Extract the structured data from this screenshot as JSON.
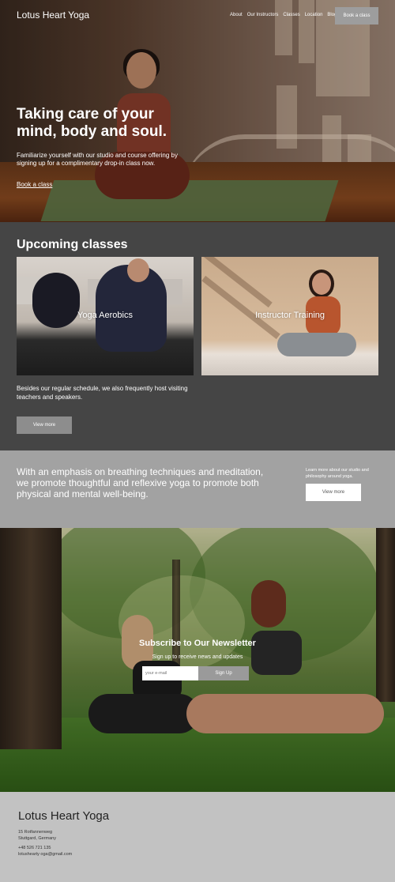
{
  "nav": {
    "logo": "Lotus Heart Yoga",
    "links": [
      "About",
      "Our Instructors",
      "Classes",
      "Location",
      "Blog"
    ],
    "cta": "Book a class"
  },
  "hero": {
    "title": "Taking care of your mind, body and soul.",
    "subtitle": "Familiarize yourself with our studio and course offering by signing up for a complimentary drop-in class now.",
    "link": "Book a class"
  },
  "classes": {
    "title": "Upcoming classes",
    "cards": [
      {
        "label": "Yoga Aerobics"
      },
      {
        "label": "Instructor Training"
      }
    ],
    "text": "Besides our regular schedule, we also frequently host visiting teachers and speakers.",
    "button": "View more"
  },
  "about": {
    "text": "With an emphasis on breathing techniques and meditation, we promote thoughtful and reflexive yoga to promote both physical and mental well-being.",
    "small": "Learn more about our studio and philosophy around yoga.",
    "button": "View more"
  },
  "newsletter": {
    "title": "Subscribe to Our Newsletter",
    "subtitle": "Sign up to receive news and updates",
    "placeholder": "your e-mail",
    "button": "Sign Up"
  },
  "footer": {
    "logo": "Lotus Heart Yoga",
    "street": "15 Rotfannenweg",
    "city": "Stuttgard, Germany",
    "phone": "+48 526 721 135",
    "email": "lotushearty oga@gmail.com"
  }
}
